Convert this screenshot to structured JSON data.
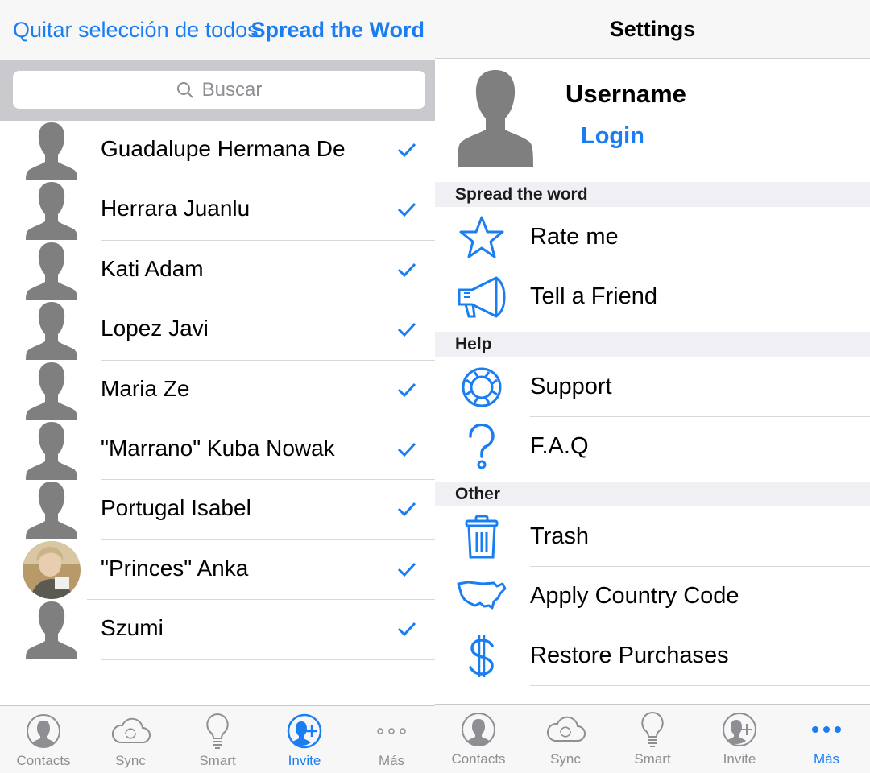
{
  "left": {
    "header": {
      "deselect_label": "Quitar selección de todos",
      "title": "Spread the Word"
    },
    "search": {
      "placeholder": "Buscar"
    },
    "contacts": [
      {
        "name": "Guadalupe Hermana De",
        "checked": true
      },
      {
        "name": "Herrara Juanlu",
        "checked": true
      },
      {
        "name": "Kati Adam",
        "checked": true
      },
      {
        "name": "Lopez Javi",
        "checked": true
      },
      {
        "name": "Maria Ze",
        "checked": true
      },
      {
        "name": "\"Marrano\" Kuba Nowak",
        "checked": true
      },
      {
        "name": "Portugal Isabel",
        "checked": true
      },
      {
        "name": "\"Princes\" Anka",
        "checked": true
      },
      {
        "name": "Szumi",
        "checked": true
      }
    ],
    "tabs": [
      {
        "label": "Contacts",
        "icon": "contacts-icon",
        "active": false
      },
      {
        "label": "Sync",
        "icon": "cloud-sync-icon",
        "active": false
      },
      {
        "label": "Smart",
        "icon": "lightbulb-icon",
        "active": false
      },
      {
        "label": "Invite",
        "icon": "invite-icon",
        "active": true
      },
      {
        "label": "Más",
        "icon": "more-icon",
        "active": false
      }
    ]
  },
  "right": {
    "header": {
      "title": "Settings"
    },
    "profile": {
      "username": "Username",
      "login_label": "Login"
    },
    "sections": [
      {
        "title": "Spread the word",
        "items": [
          {
            "label": "Rate me",
            "icon": "star-icon"
          },
          {
            "label": "Tell a Friend",
            "icon": "megaphone-icon"
          }
        ]
      },
      {
        "title": "Help",
        "items": [
          {
            "label": "Support",
            "icon": "lifebuoy-icon"
          },
          {
            "label": "F.A.Q",
            "icon": "question-icon"
          }
        ]
      },
      {
        "title": "Other",
        "items": [
          {
            "label": "Trash",
            "icon": "trash-icon"
          },
          {
            "label": "Apply Country Code",
            "icon": "usa-map-icon"
          },
          {
            "label": "Restore Purchases",
            "icon": "dollar-icon"
          }
        ]
      }
    ],
    "tabs": [
      {
        "label": "Contacts",
        "icon": "contacts-icon",
        "active": false
      },
      {
        "label": "Sync",
        "icon": "cloud-sync-icon",
        "active": false
      },
      {
        "label": "Smart",
        "icon": "lightbulb-icon",
        "active": false
      },
      {
        "label": "Invite",
        "icon": "invite-icon",
        "active": false
      },
      {
        "label": "Más",
        "icon": "more-icon",
        "active": true
      }
    ]
  },
  "colors": {
    "accent": "#1a7ef2",
    "avatar_gray": "#7f7f7f",
    "section_bg": "#efeff4"
  }
}
